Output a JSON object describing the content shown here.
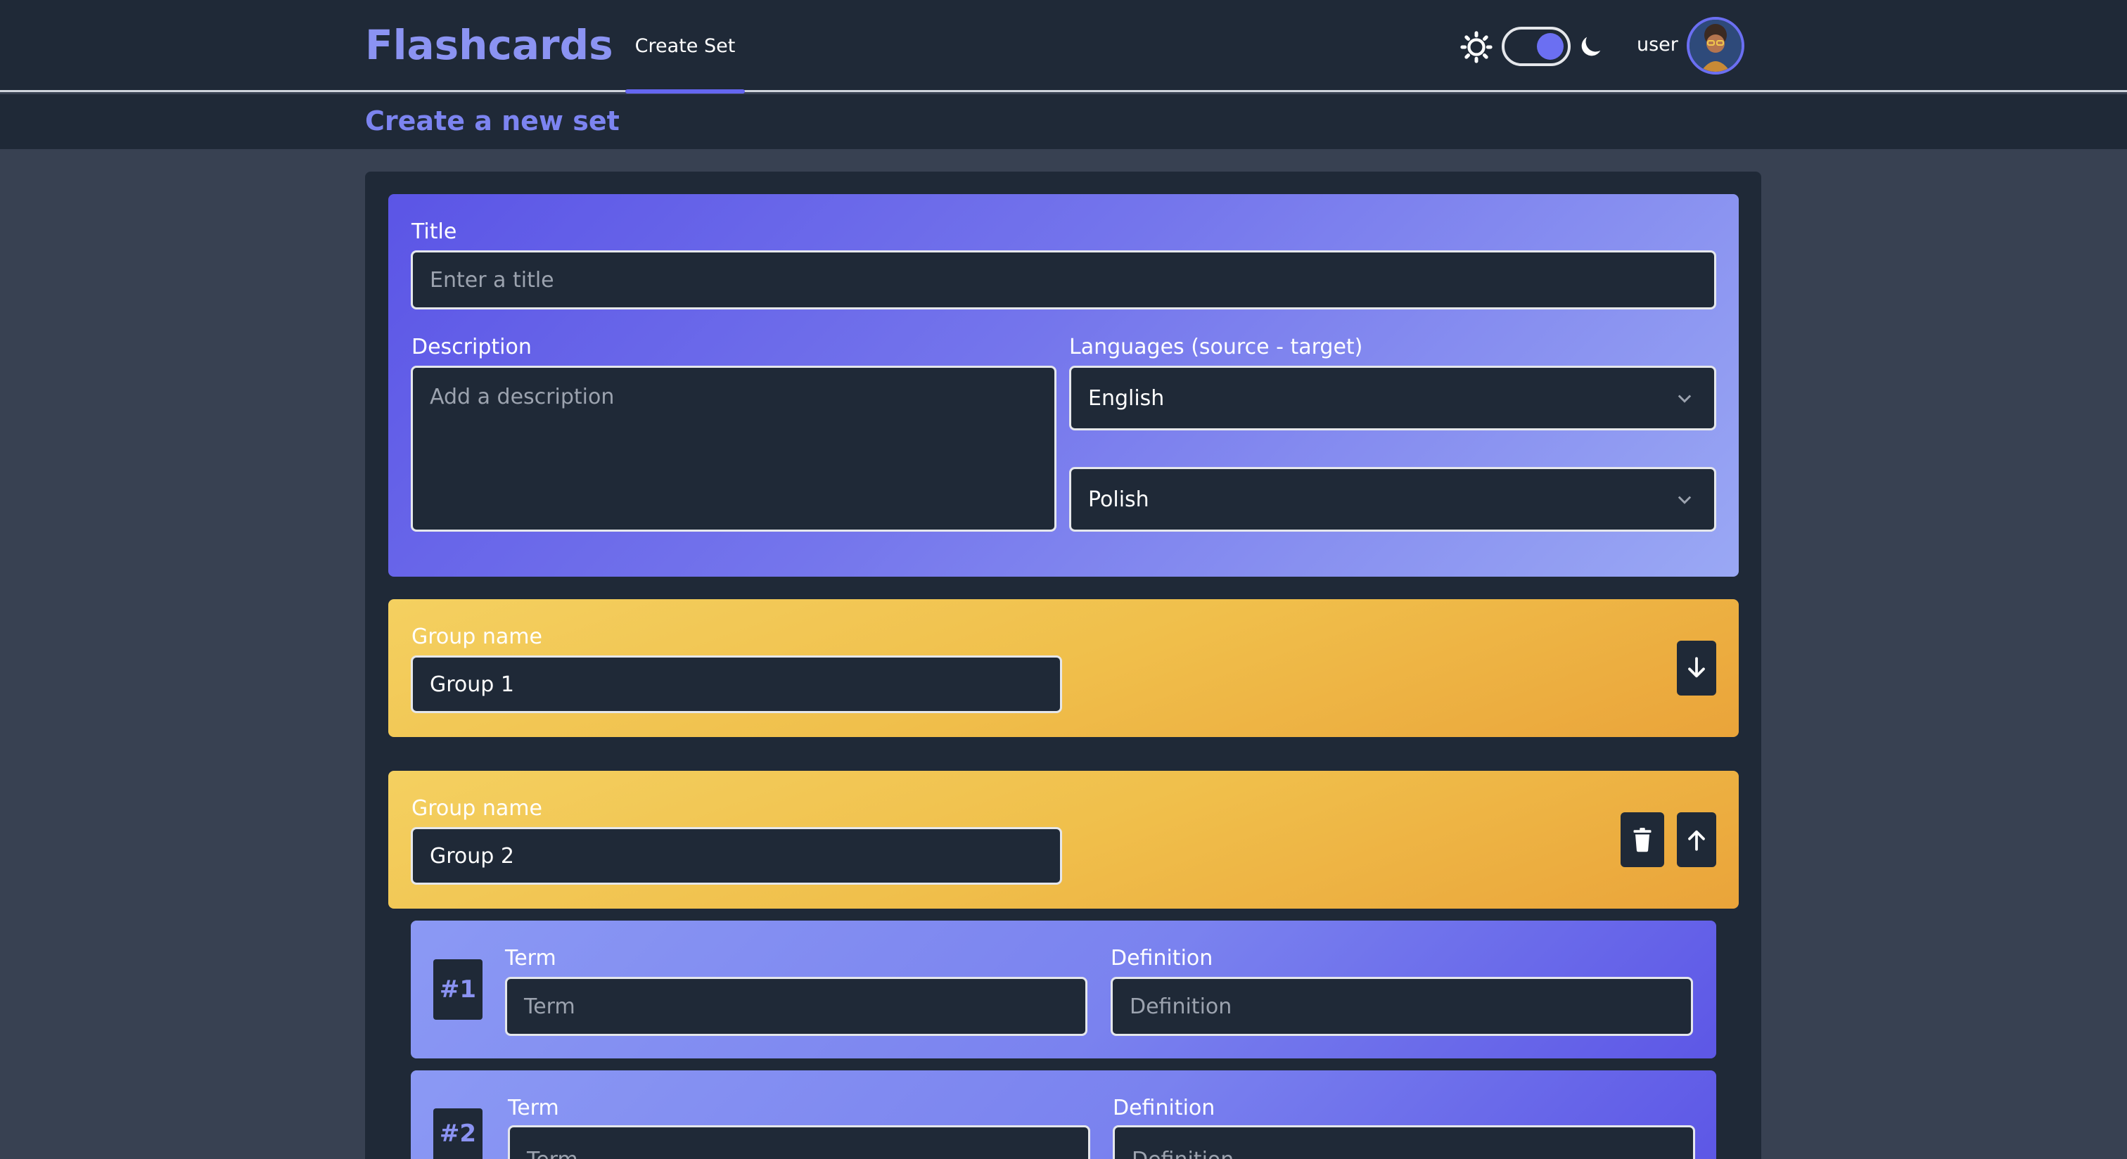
{
  "header": {
    "brand": "Flashcards",
    "nav_tab": "Create Set",
    "user_label": "user",
    "icons": [
      "sun-icon",
      "theme-toggle",
      "moon-icon",
      "avatar"
    ],
    "accent_color": "#6466f0"
  },
  "subheader": {
    "title": "Create a new set"
  },
  "set_form": {
    "title_label": "Title",
    "title_placeholder": "Enter a title",
    "description_label": "Description",
    "description_placeholder": "Add a description",
    "languages_label": "Languages (source - target)",
    "source_language": "English",
    "target_language": "Polish"
  },
  "groups": [
    {
      "name_label": "Group name",
      "name_value": "Group 1",
      "actions": [
        "move-down"
      ]
    },
    {
      "name_label": "Group name",
      "name_value": "Group 2",
      "actions": [
        "delete",
        "move-up"
      ],
      "cards": [
        {
          "number": "#1",
          "term_label": "Term",
          "term_placeholder": "Term",
          "definition_label": "Definition",
          "definition_placeholder": "Definition"
        },
        {
          "number": "#2",
          "term_label": "Term",
          "term_placeholder": "Term",
          "definition_label": "Definition",
          "definition_placeholder": "Definition"
        }
      ]
    }
  ]
}
